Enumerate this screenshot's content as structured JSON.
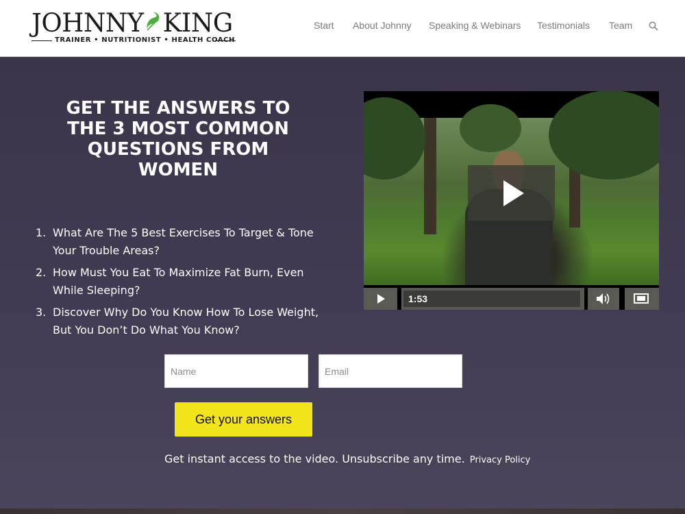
{
  "header": {
    "logo": {
      "name_left": "JOHNNY",
      "name_right": "KING",
      "tagline": "TRAINER • NUTRITIONIST • HEALTH COACH"
    },
    "nav": [
      {
        "label": "Start"
      },
      {
        "label": "About Johnny"
      },
      {
        "label": "Speaking & Webinars"
      },
      {
        "label": "Testimonials"
      },
      {
        "label": "Team"
      }
    ],
    "search_icon": "search-icon"
  },
  "hero": {
    "headline": "GET THE ANSWERS TO THE 3 MOST COMMON QUESTIONS FROM WOMEN",
    "questions": [
      {
        "num": "1.",
        "text": "What Are The 5 Best Exercises To Target & Tone Your Trouble Areas?"
      },
      {
        "num": "2.",
        "text": "How Must You Eat To Maximize Fat Burn, Even While Sleeping?"
      },
      {
        "num": "3.",
        "text": "Discover Why Do You Know How To Lose Weight, But You Don’t Do What You Know?"
      }
    ]
  },
  "video": {
    "duration": "1:53",
    "icons": {
      "play": "play-icon",
      "volume": "volume-icon",
      "fullscreen": "fullscreen-icon"
    }
  },
  "form": {
    "name_placeholder": "Name",
    "email_placeholder": "Email",
    "submit_label": "Get your answers",
    "disclaimer": "Get instant access to the video. Unsubscribe any time.",
    "privacy_label": "Privacy Policy"
  },
  "colors": {
    "hero_bg": "#413a52",
    "button": "#f2e31b",
    "logo_green": "#4caf3c",
    "nav_text": "#7a7a7a"
  }
}
